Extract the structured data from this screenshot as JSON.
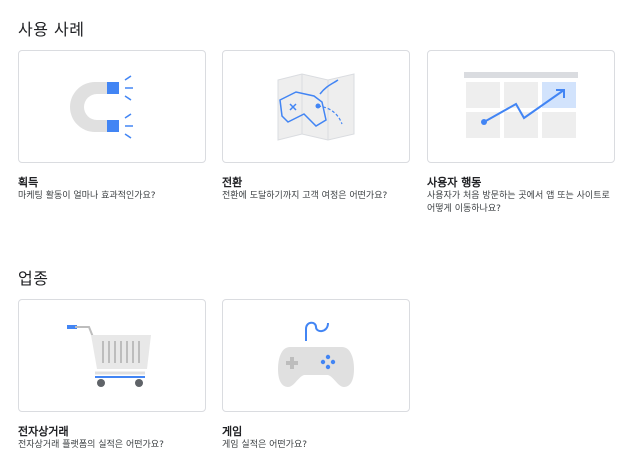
{
  "sections": [
    {
      "title": "사용 사례",
      "cards": [
        {
          "title": "획득",
          "description": "마케팅 활동이 얼마나 효과적인가요?",
          "icon": "magnet-icon"
        },
        {
          "title": "전환",
          "description": "전환에 도달하기까지 고객 여정은 어떤가요?",
          "icon": "map-icon"
        },
        {
          "title": "사용자 행동",
          "description": "사용자가 처음 방문하는 곳에서 앱 또는 사이트로 어떻게 이동하나요?",
          "icon": "trend-chart-icon"
        }
      ]
    },
    {
      "title": "업종",
      "cards": [
        {
          "title": "전자상거래",
          "description": "전자상거래 플랫폼의 실적은 어떤가요?",
          "icon": "shopping-cart-icon"
        },
        {
          "title": "게임",
          "description": "게임 실적은 어떤가요?",
          "icon": "gamepad-icon"
        }
      ]
    }
  ],
  "colors": {
    "accent_blue": "#4285f4",
    "icon_gray": "#dadce0",
    "border": "#dadce0"
  }
}
